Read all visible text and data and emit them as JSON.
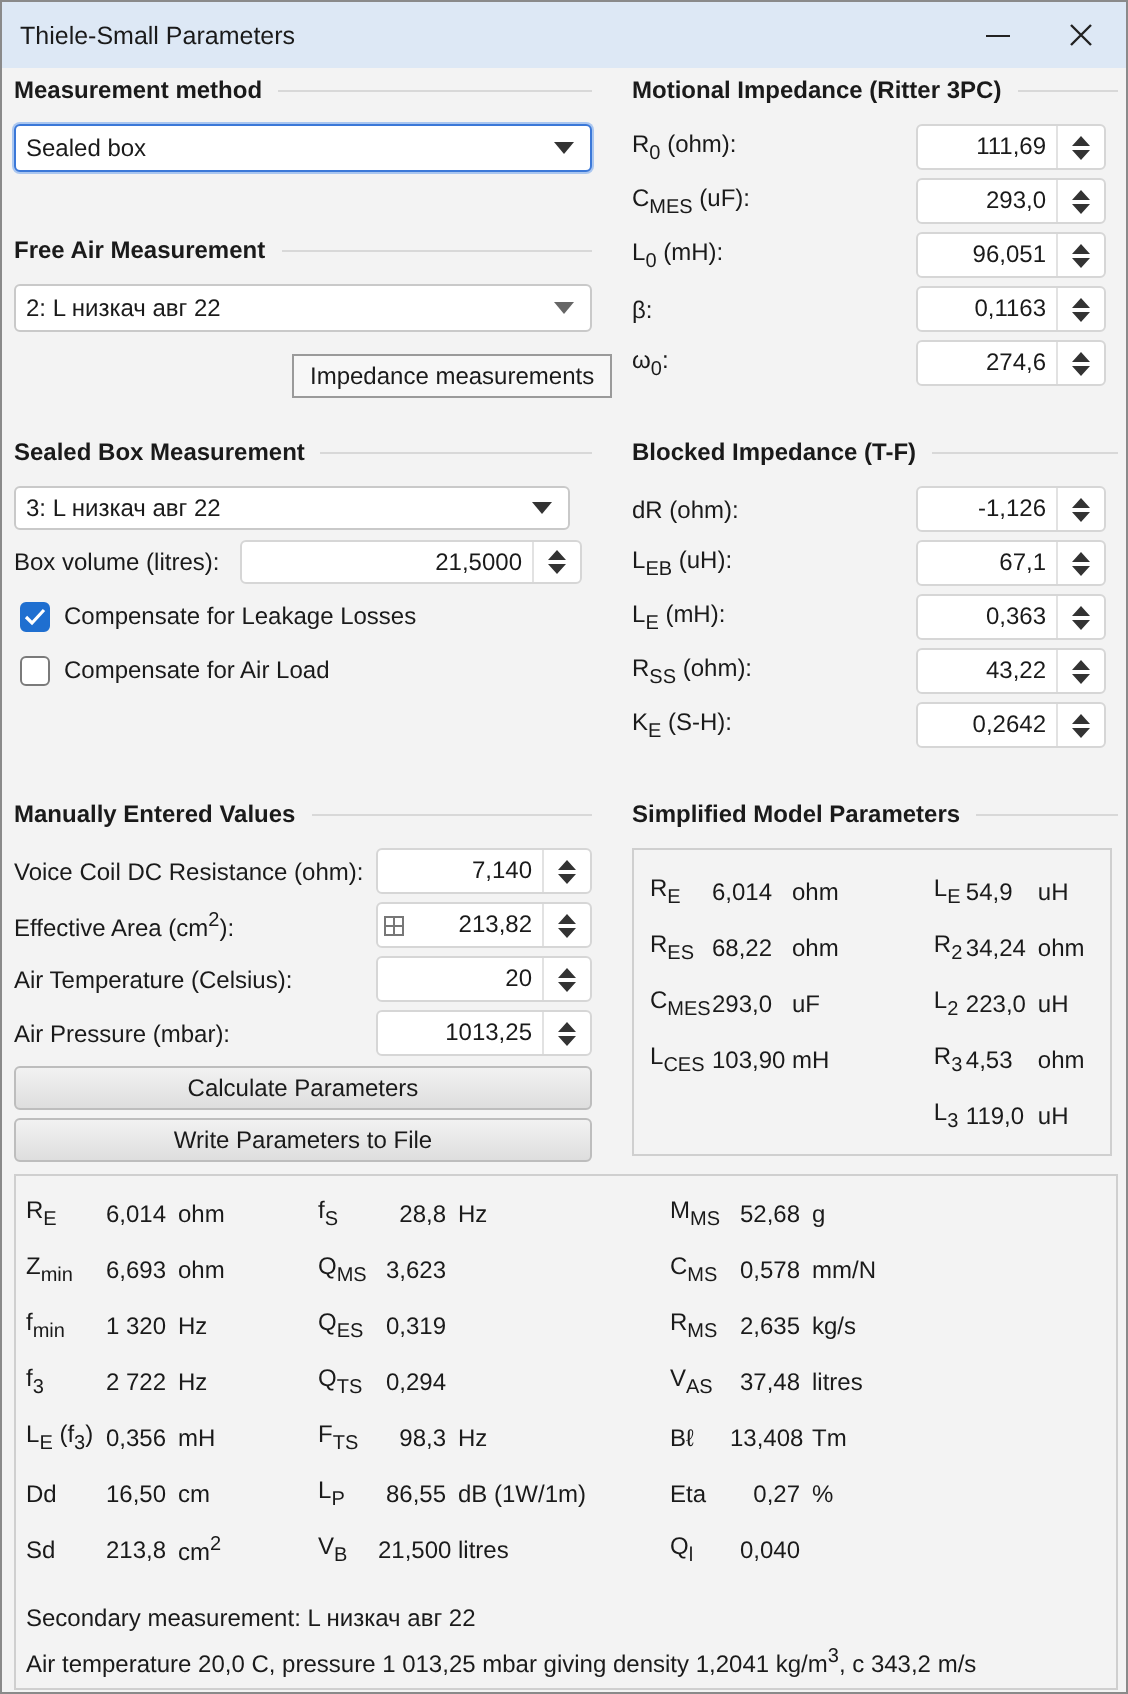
{
  "window": {
    "title": "Thiele-Small Parameters"
  },
  "measurement_method": {
    "heading": "Measurement method",
    "dropdown": {
      "value": "Sealed box",
      "focused": true
    }
  },
  "free_air": {
    "heading": "Free Air Measurement",
    "dropdown": {
      "value": "2: L низкач авг 22",
      "focused": false
    },
    "tooltip": "Impedance measurements"
  },
  "sealed_box": {
    "heading": "Sealed Box Measurement",
    "dropdown": {
      "value": "3: L низкач авг 22",
      "focused": false
    },
    "box_volume": {
      "label": "Box volume (litres):",
      "value": "21,5000"
    },
    "checkboxes": [
      {
        "label": "Compensate for Leakage Losses",
        "checked": true
      },
      {
        "label": "Compensate for Air Load",
        "checked": false
      }
    ]
  },
  "manual": {
    "heading": "Manually Entered Values",
    "fields": [
      {
        "label": "Voice Coil DC Resistance (ohm):",
        "value": "7,140",
        "calculator": false
      },
      {
        "label": "Effective Area (cm$^{2}$):",
        "value": "213,82",
        "calculator": true
      },
      {
        "label": "Air Temperature (Celsius):",
        "value": "20",
        "calculator": false
      },
      {
        "label": "Air Pressure (mbar):",
        "value": "1013,25",
        "calculator": false
      }
    ],
    "buttons": [
      "Calculate Parameters",
      "Write Parameters to File"
    ]
  },
  "motional": {
    "heading": "Motional Impedance (Ritter 3PC)",
    "fields": [
      {
        "label": "R$_{0}$ (ohm):",
        "value": "111,69"
      },
      {
        "label": "C$_{MES}$ (uF):",
        "value": "293,0"
      },
      {
        "label": "L$_{0}$ (mH):",
        "value": "96,051"
      },
      {
        "label": "β:",
        "value": "0,1163"
      },
      {
        "label": "ω$_{0}$:",
        "value": "274,6"
      }
    ]
  },
  "blocked": {
    "heading": "Blocked Impedance (T-F)",
    "fields": [
      {
        "label": "dR (ohm):",
        "value": "-1,126"
      },
      {
        "label": "L$_{EB}$ (uH):",
        "value": "67,1"
      },
      {
        "label": "L$_{E}$ (mH):",
        "value": "0,363"
      },
      {
        "label": "R$_{SS}$ (ohm):",
        "value": "43,22"
      },
      {
        "label": "K$_{E}$ (S-H):",
        "value": "0,2642"
      }
    ]
  },
  "simplified": {
    "heading": "Simplified Model Parameters",
    "left": [
      {
        "label": "R$_{E}$",
        "value": "6,014",
        "unit": "ohm"
      },
      {
        "label": "R$_{ES}$",
        "value": "68,22",
        "unit": "ohm"
      },
      {
        "label": "C$_{MES}$",
        "value": "293,0",
        "unit": "uF"
      },
      {
        "label": "L$_{CES}$",
        "value": "103,90",
        "unit": "mH"
      }
    ],
    "right": [
      {
        "label": "L$_{E}$",
        "value": "54,9",
        "unit": "uH"
      },
      {
        "label": "R$_{2}$",
        "value": "34,24",
        "unit": "ohm"
      },
      {
        "label": "L$_{2}$",
        "value": "223,0",
        "unit": "uH"
      },
      {
        "label": "R$_{3}$",
        "value": "4,53",
        "unit": "ohm"
      },
      {
        "label": "L$_{3}$",
        "value": "119,0",
        "unit": "uH"
      }
    ]
  },
  "results": {
    "rows": [
      [
        {
          "label": "R$_{E}$",
          "value": "6,014",
          "unit": "ohm"
        },
        {
          "label": "f$_{S}$",
          "value": "28,8",
          "unit": "Hz"
        },
        {
          "label": "M$_{MS}$",
          "value": "52,68",
          "unit": "g"
        }
      ],
      [
        {
          "label": "Z$_{min}$",
          "value": "6,693",
          "unit": "ohm"
        },
        {
          "label": "Q$_{MS}$",
          "value": "3,623"
        },
        {
          "label": "C$_{MS}$",
          "value": "0,578",
          "unit": "mm/N"
        }
      ],
      [
        {
          "label": "f$_{min}$",
          "value": "1 320",
          "unit": "Hz"
        },
        {
          "label": "Q$_{ES}$",
          "value": "0,319"
        },
        {
          "label": "R$_{MS}$",
          "value": "2,635",
          "unit": "kg/s"
        }
      ],
      [
        {
          "label": "f$_{3}$",
          "value": "2 722",
          "unit": "Hz"
        },
        {
          "label": "Q$_{TS}$",
          "value": "0,294"
        },
        {
          "label": "V$_{AS}$",
          "value": "37,48",
          "unit": "litres"
        }
      ],
      [
        {
          "label": "L$_{E}$ (f$_{3}$)",
          "value": "0,356",
          "unit": "mH"
        },
        {
          "label": "F$_{TS}$",
          "value": "98,3",
          "unit": "Hz"
        },
        {
          "label": "Bℓ",
          "value": "13,408",
          "unit": "Tm"
        }
      ],
      [
        {
          "label": "Dd",
          "value": "16,50",
          "unit": "cm"
        },
        {
          "label": "L$_{P}$",
          "value": "86,55",
          "unit": "dB (1W/1m)"
        },
        {
          "label": "Eta",
          "value": "0,27",
          "unit": "%"
        }
      ],
      [
        {
          "label": "Sd",
          "value": "213,8",
          "unit": "cm$^{2}$"
        },
        {
          "label": "V$_{B}$",
          "value": "21,500",
          "unit": "litres"
        },
        {
          "label": "Q$_{l}$",
          "value": "0,040"
        }
      ]
    ],
    "notes": [
      "Secondary measurement: L низкач авг 22",
      "Air temperature 20,0 C, pressure 1 013,25 mbar giving density 1,2041 kg/m$^{3}$, c 343,2 m/s"
    ]
  }
}
